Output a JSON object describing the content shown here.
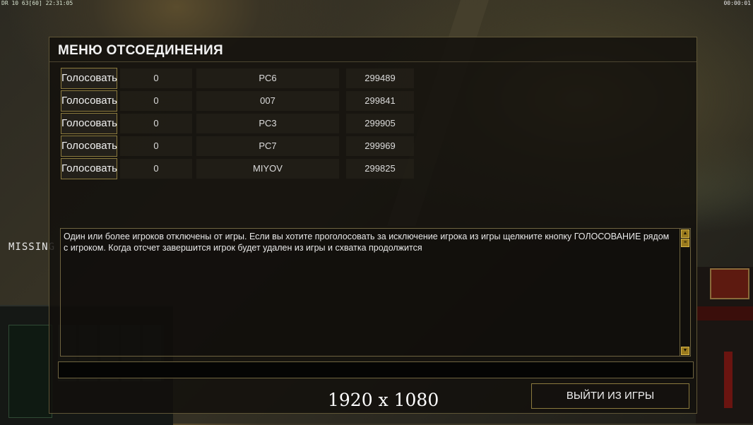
{
  "overlay": {
    "top_left_stats": "DR 10 63[60] 22:31:05",
    "top_right_timer": "00:00:01",
    "missing_label": "MISSING",
    "resolution_label": "1920 x 1080"
  },
  "dialog": {
    "title": "МЕНЮ ОТСОЕДИНЕНИЯ",
    "vote_label": "Голосовать",
    "players": [
      {
        "votes": "0",
        "name": "PC6",
        "frame": "299489"
      },
      {
        "votes": "0",
        "name": "007",
        "frame": "299841"
      },
      {
        "votes": "0",
        "name": "PC3",
        "frame": "299905"
      },
      {
        "votes": "0",
        "name": "PC7",
        "frame": "299969"
      },
      {
        "votes": "0",
        "name": "MIYOV",
        "frame": "299825"
      }
    ],
    "message": "Один или более игроков отключены от игры. Если вы хотите проголосовать за исключение игрока из игры щелкните кнопку ГОЛОСОВАНИЕ рядом с игроком. Когда отсчет завершится игрок будет удален из игры и схватка продолжится",
    "chat_value": "",
    "quit_label": "ВЫЙТИ ИЗ ИГРЫ"
  },
  "colors": {
    "border_gold": "#8b7a3e",
    "panel_bg": "#12100c"
  }
}
